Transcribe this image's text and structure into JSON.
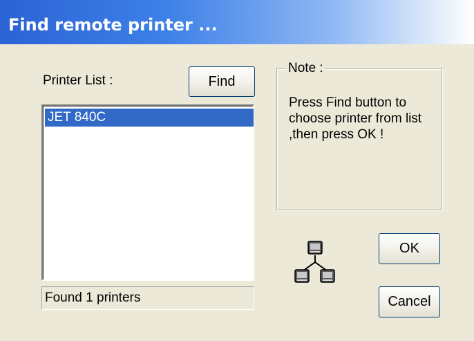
{
  "window": {
    "title": "Find remote printer ..."
  },
  "printer_list": {
    "label": "Printer List :",
    "items": [
      "JET 840C"
    ],
    "selected_index": 0
  },
  "find_button": {
    "label": "Find"
  },
  "status": {
    "text": "Found 1 printers"
  },
  "note": {
    "legend": "Note :",
    "lines": [
      "Press Find button to",
      "choose printer from list",
      ",then press OK !"
    ]
  },
  "icons": {
    "network": "network-printers-icon"
  },
  "buttons": {
    "ok": "OK",
    "cancel": "Cancel"
  },
  "colors": {
    "selection": "#3169c6",
    "dialog_bg": "#ece9d8",
    "title_start": "#2b63d4"
  }
}
